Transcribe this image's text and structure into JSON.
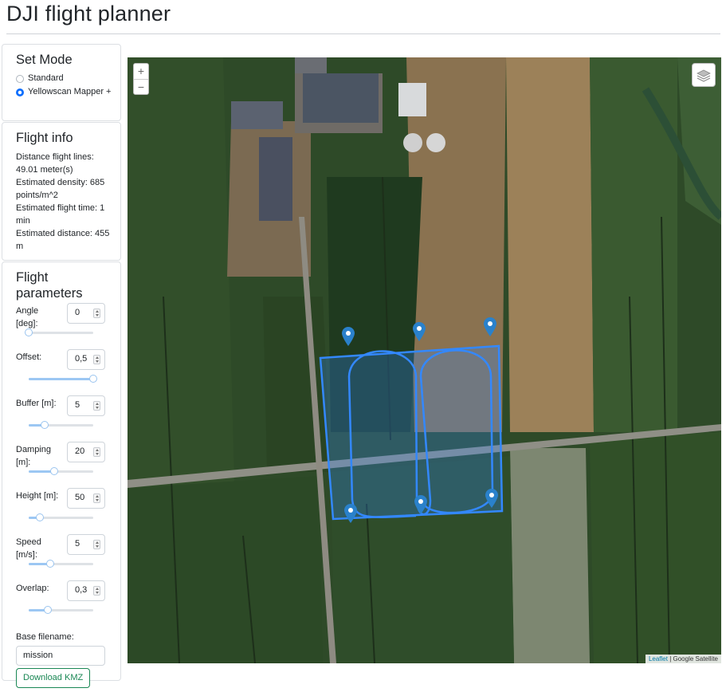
{
  "page": {
    "title": "DJI flight planner"
  },
  "mode": {
    "title": "Set Mode",
    "options": [
      {
        "label": "Standard",
        "selected": false
      },
      {
        "label": "Yellowscan Mapper +",
        "selected": true
      }
    ]
  },
  "flight_info": {
    "title": "Flight info",
    "lines": [
      "Distance flight lines: 49.01 meter(s)",
      "Estimated density: 685 points/m^2",
      "Estimated flight time: 1 min",
      "Estimated distance: 455 m"
    ]
  },
  "params": {
    "title": "Flight parameters",
    "fields": [
      {
        "label": "Angle [deg]:",
        "value": "0",
        "level": 0.0
      },
      {
        "label": "Offset:",
        "value": "0,5",
        "level": 1.0
      },
      {
        "label": "Buffer [m]:",
        "value": "5",
        "level": 0.25
      },
      {
        "label": "Damping [m]:",
        "value": "20",
        "level": 0.4
      },
      {
        "label": "Height [m]:",
        "value": "50",
        "level": 0.17
      },
      {
        "label": "Speed [m/s]:",
        "value": "5",
        "level": 0.33
      },
      {
        "label": "Overlap:",
        "value": "0,3",
        "level": 0.3
      }
    ],
    "filename_label": "Base filename:",
    "filename_value": "mission",
    "download_label": "Download KMZ"
  },
  "map": {
    "zoom_in": "+",
    "zoom_out": "−",
    "attribution_link": "Leaflet",
    "attribution_text": " | Google Satellite",
    "polygon_color": "#3388ff",
    "marker_color": "#2a81cb"
  }
}
